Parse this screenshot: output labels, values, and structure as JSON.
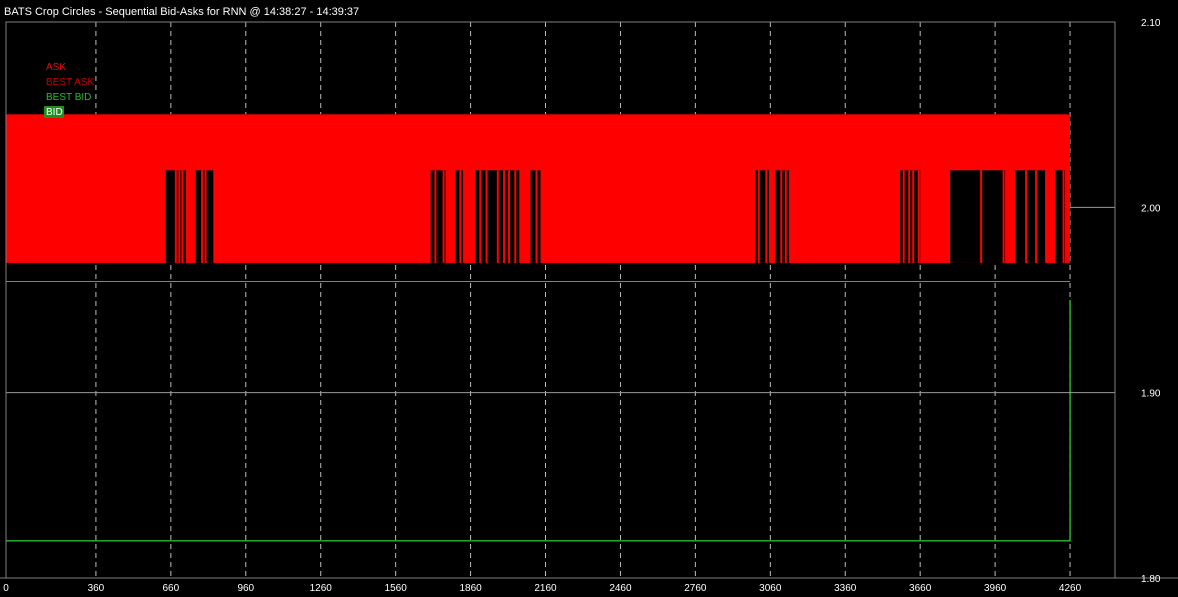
{
  "window": {
    "title": "BATS Crop Circles - Sequential Bid-Asks for  RNN  @ 14:38:27 - 14:39:37"
  },
  "colors": {
    "background": "#000000",
    "frame": "#808080",
    "grid": "#bdbdbd",
    "ask": "#ff0000",
    "best_ask": "#c80000",
    "best_bid": "#22c322",
    "bid": "#3cff3c",
    "text": "#ffffff"
  },
  "chart_data": {
    "type": "line",
    "title": "BATS Crop Circles - Sequential Bid-Asks for  RNN  @ 14:38:27 - 14:39:37",
    "xlim": [
      0,
      4440
    ],
    "ylim": [
      1.8,
      2.1
    ],
    "x_ticks": [
      0,
      360,
      660,
      960,
      1260,
      1560,
      1860,
      2160,
      2460,
      2760,
      3060,
      3360,
      3660,
      3960,
      4260
    ],
    "x_tick_labels": [
      "0",
      "360",
      "660",
      "960",
      "1260",
      "1560",
      "1860",
      "2160",
      "2460",
      "2760",
      "3060",
      "3360",
      "3660",
      "3960",
      "4260"
    ],
    "y_ticks": [
      2.1,
      2.0,
      1.9,
      1.8
    ],
    "y_tick_labels": [
      "2.10",
      "2.00",
      "1.90",
      "1.80"
    ],
    "grid": true,
    "legend_position": "top-left",
    "legend": [
      {
        "label": "ASK",
        "color_key": "ask"
      },
      {
        "label": "BEST ASK",
        "color_key": "best_ask"
      },
      {
        "label": "BEST BID",
        "color_key": "best_bid"
      },
      {
        "label": "BID",
        "color_key": "bid"
      }
    ],
    "series": [
      {
        "name": "ASK",
        "band": [
          1.97,
          2.05
        ],
        "gaps_low": 2.02,
        "gaps": [
          [
            640,
            720
          ],
          [
            760,
            830
          ],
          [
            1700,
            1760
          ],
          [
            1800,
            1830
          ],
          [
            1880,
            2060
          ],
          [
            2100,
            2140
          ],
          [
            3000,
            3060
          ],
          [
            3080,
            3140
          ],
          [
            3580,
            3660
          ],
          [
            3780,
            4000
          ],
          [
            4040,
            4160
          ],
          [
            4200,
            4240
          ]
        ],
        "spikes": [
          676,
          690,
          702,
          735,
          781,
          795,
          1715,
          1748,
          1815,
          1895,
          1920,
          1965,
          1990,
          2010,
          2035,
          2055,
          2120,
          2155,
          2255,
          3010,
          3040,
          3055,
          3100,
          3118,
          3135,
          3170,
          3590,
          3612,
          3628,
          3650,
          3700,
          3730,
          3900,
          3990,
          4080,
          4120,
          4230
        ]
      },
      {
        "name": "BEST ASK",
        "points": [
          [
            0,
            2.05
          ],
          [
            4260,
            2.05
          ]
        ]
      },
      {
        "name": "BEST BID",
        "points": [
          [
            0,
            1.96
          ],
          [
            4260,
            1.96
          ]
        ]
      },
      {
        "name": "BID",
        "points": [
          [
            0,
            1.82
          ],
          [
            4260,
            1.82
          ],
          [
            4260,
            1.95
          ]
        ]
      }
    ]
  }
}
